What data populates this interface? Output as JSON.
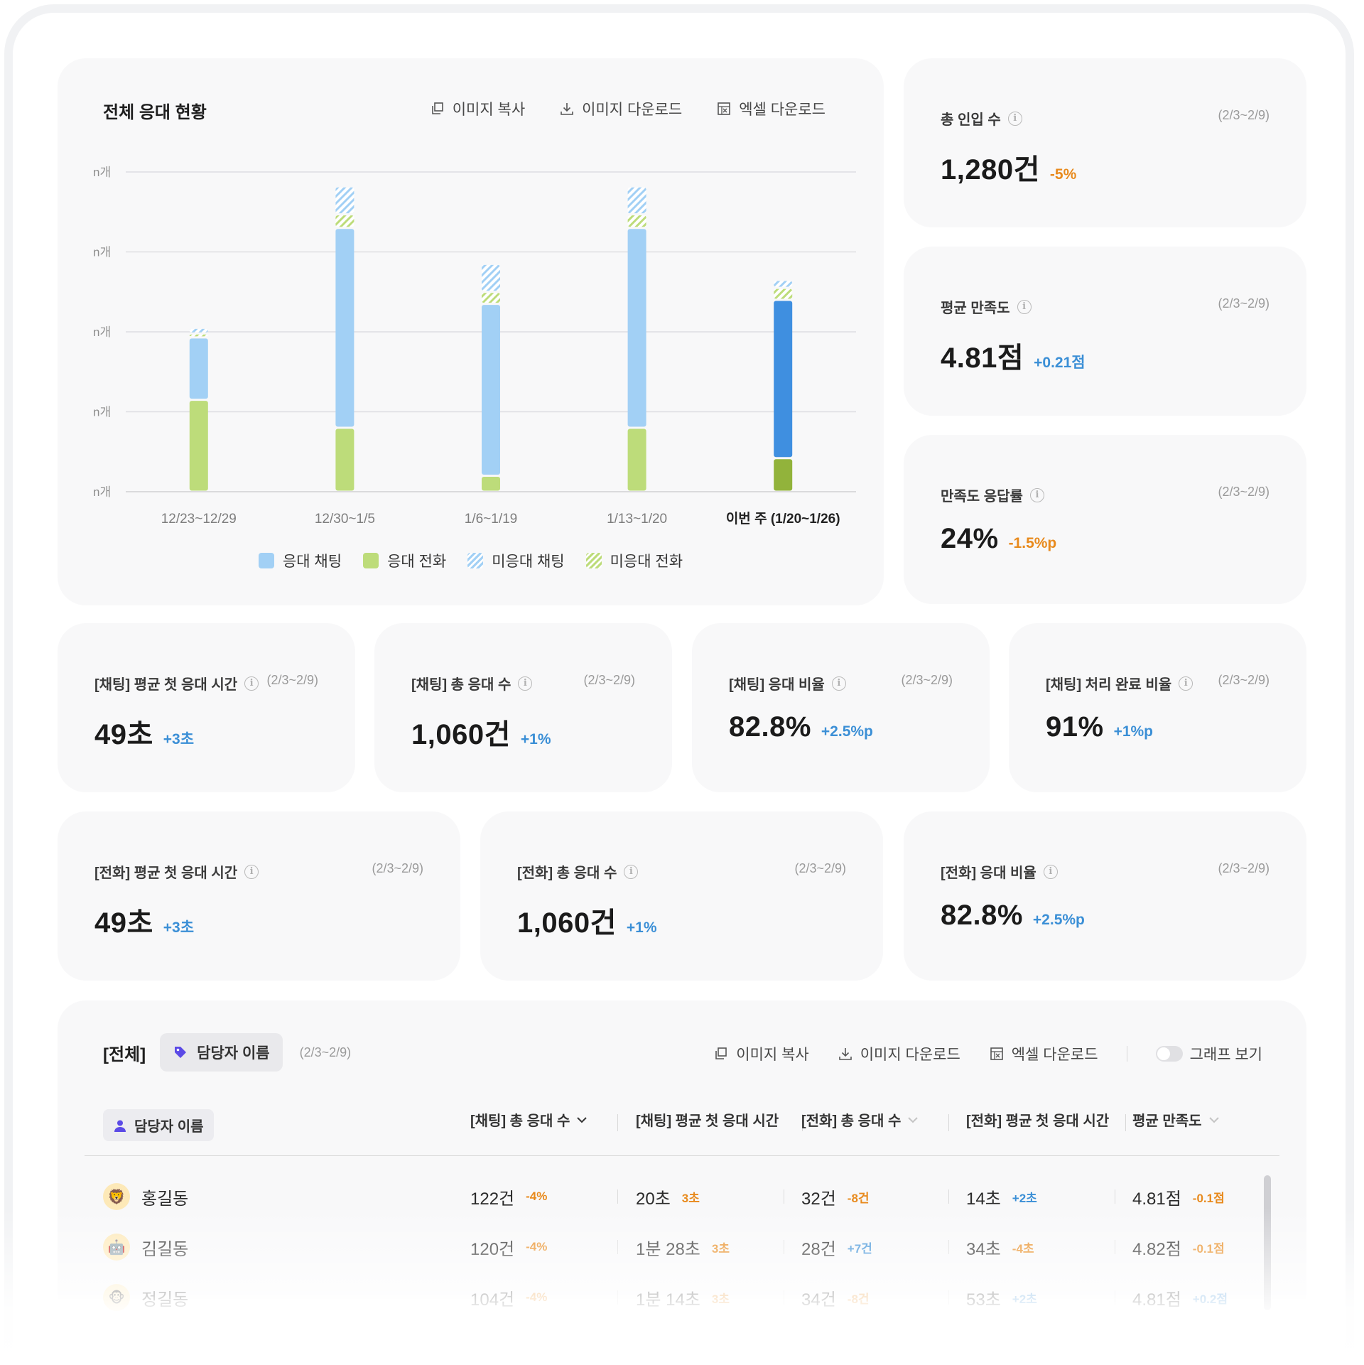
{
  "chart_card": {
    "title": "전체 응대 현황",
    "tools": {
      "copy": "이미지 복사",
      "download": "이미지 다운로드",
      "excel": "엑셀 다운로드"
    }
  },
  "chart_data": {
    "type": "bar",
    "stacked": true,
    "title": "전체 응대 현황",
    "y_tick_labels": [
      "n개",
      "n개",
      "n개",
      "n개",
      "n개"
    ],
    "categories": [
      "12/23~12/29",
      "12/30~1/5",
      "1/6~1/19",
      "1/13~1/20",
      "이번 주 (1/20~1/26)"
    ],
    "highlight_category": "이번 주 (1/20~1/26)",
    "ylim": [
      0,
      4
    ],
    "grid": true,
    "legend_position": "bottom",
    "series": [
      {
        "name": "응대 전화",
        "values": [
          1.15,
          0.8,
          0.2,
          0.8,
          0.42
        ],
        "color": "#bddc7a",
        "highlight_color": "#92b33b",
        "pattern": "solid"
      },
      {
        "name": "응대 채팅",
        "values": [
          0.78,
          2.5,
          2.15,
          2.5,
          1.98
        ],
        "color": "#a2d0f5",
        "highlight_color": "#3f8fe0",
        "pattern": "solid"
      },
      {
        "name": "미응대 전화",
        "values": [
          0.05,
          0.17,
          0.15,
          0.17,
          0.15
        ],
        "color": "#bddc7a",
        "pattern": "hatched"
      },
      {
        "name": "미응대 채팅",
        "values": [
          0.07,
          0.35,
          0.35,
          0.35,
          0.1
        ],
        "color": "#a2d0f5",
        "pattern": "hatched"
      }
    ],
    "legend": [
      "응대 채팅",
      "응대 전화",
      "미응대 채팅",
      "미응대 전화"
    ]
  },
  "side_metrics": [
    {
      "label": "총 인입 수",
      "period": "(2/3~2/9)",
      "value": "1,280건",
      "delta": "-5%",
      "trend": "down"
    },
    {
      "label": "평균 만족도",
      "period": "(2/3~2/9)",
      "value": "4.81점",
      "delta": "+0.21점",
      "trend": "up"
    },
    {
      "label": "만족도 응답률",
      "period": "(2/3~2/9)",
      "value": "24%",
      "delta": "-1.5%p",
      "trend": "down"
    }
  ],
  "chat_metrics": [
    {
      "label": "[채팅] 평균 첫 응대 시간",
      "period": "(2/3~2/9)",
      "value": "49초",
      "delta": "+3초",
      "trend": "up"
    },
    {
      "label": "[채팅] 총 응대 수",
      "period": "(2/3~2/9)",
      "value": "1,060건",
      "delta": "+1%",
      "trend": "up"
    },
    {
      "label": "[채팅] 응대 비율",
      "period": "(2/3~2/9)",
      "value": "82.8%",
      "delta": "+2.5%p",
      "trend": "up"
    },
    {
      "label": "[채팅] 처리 완료 비율",
      "period": "(2/3~2/9)",
      "value": "91%",
      "delta": "+1%p",
      "trend": "up"
    }
  ],
  "call_metrics": [
    {
      "label": "[전화] 평균 첫 응대 시간",
      "period": "(2/3~2/9)",
      "value": "49초",
      "delta": "+3초",
      "trend": "up"
    },
    {
      "label": "[전화] 총 응대 수",
      "period": "(2/3~2/9)",
      "value": "1,060건",
      "delta": "+1%",
      "trend": "up"
    },
    {
      "label": "[전화] 응대 비율",
      "period": "(2/3~2/9)",
      "value": "82.8%",
      "delta": "+2.5%p",
      "trend": "up"
    }
  ],
  "table": {
    "scope": "[전체]",
    "group_chip": "담당자 이름",
    "period": "(2/3~2/9)",
    "tools": {
      "copy": "이미지 복사",
      "download": "이미지 다운로드",
      "excel": "엑셀 다운로드",
      "graph_toggle": "그래프 보기"
    },
    "graph_toggle_on": false,
    "columns": [
      "담당자 이름",
      "[채팅] 총 응대 수",
      "[채팅] 평균 첫 응대 시간",
      "[전화] 총 응대 수",
      "[전화] 평균 첫 응대 시간",
      "평균 만족도"
    ],
    "rows": [
      {
        "avatar": "🦁",
        "name": "홍길동",
        "chat_total": "122건",
        "chat_total_delta": "-4%",
        "chat_total_trend": "down",
        "chat_first": "20초",
        "chat_first_delta": "3초",
        "chat_first_trend": "down",
        "call_total": "32건",
        "call_total_delta": "-8건",
        "call_total_trend": "down",
        "call_first": "14초",
        "call_first_delta": "+2초",
        "call_first_trend": "up",
        "csat": "4.81점",
        "csat_delta": "-0.1점",
        "csat_trend": "down"
      },
      {
        "avatar": "🤖",
        "name": "김길동",
        "chat_total": "120건",
        "chat_total_delta": "-4%",
        "chat_total_trend": "down",
        "chat_first": "1분 28초",
        "chat_first_delta": "3초",
        "chat_first_trend": "down",
        "call_total": "28건",
        "call_total_delta": "+7건",
        "call_total_trend": "up",
        "call_first": "34초",
        "call_first_delta": "-4초",
        "call_first_trend": "down",
        "csat": "4.82점",
        "csat_delta": "-0.1점",
        "csat_trend": "down"
      },
      {
        "avatar": "🐵",
        "name": "정길동",
        "chat_total": "104건",
        "chat_total_delta": "-4%",
        "chat_total_trend": "down",
        "chat_first": "1분 14초",
        "chat_first_delta": "3초",
        "chat_first_trend": "down",
        "call_total": "34건",
        "call_total_delta": "-8건",
        "call_total_trend": "down",
        "call_first": "53초",
        "call_first_delta": "+2초",
        "call_first_trend": "up",
        "csat": "4.81점",
        "csat_delta": "+0.2점",
        "csat_trend": "up"
      }
    ]
  }
}
